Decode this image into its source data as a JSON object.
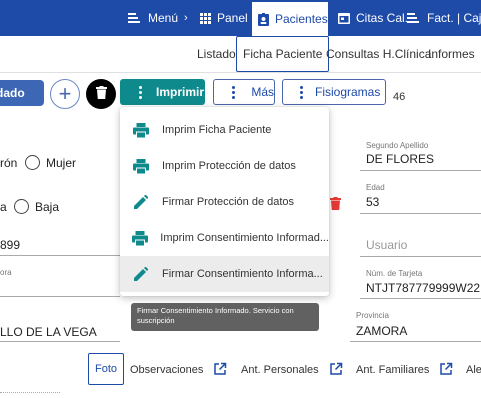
{
  "topbar": {
    "menu_label": "Menú",
    "panel_label": "Panel",
    "patients_label": "Pacientes",
    "appointments_label": "Citas Cal.",
    "billing_label": "Fact. | Caja"
  },
  "subnav": {
    "list": "Listado",
    "patient_file": "Ficha Paciente",
    "clinical_history": "Consultas H.Clínica",
    "reports": "Informes"
  },
  "toolbar": {
    "save_label": "dado",
    "add_label": "+",
    "print_label": "Imprimir",
    "more_label": "Más",
    "physiograms_label": "Fisiogramas",
    "count": "46"
  },
  "form": {
    "sex_option_male": "rón",
    "sex_option_female": "Mujer",
    "status_option_a": "a",
    "status_option_baja": "Baja",
    "phone_fragment": "899",
    "second_surname_label": "Segundo Apellido",
    "second_surname_value": "DE FLORES",
    "age_label": "Edad",
    "age_value": "53",
    "user_placeholder": "Usuario",
    "label_fragment": "ora",
    "card_number_label": "Núm. de Tarjeta",
    "card_number_value": "NTJT787779999W22",
    "town_fragment": "LLO DE LA VEGA",
    "province_label": "Provincia",
    "province_value": "ZAMORA"
  },
  "print_menu": {
    "items": [
      {
        "label": "Imprim Ficha Paciente",
        "icon": "printer-icon"
      },
      {
        "label": "Imprim Protección de datos",
        "icon": "printer-icon"
      },
      {
        "label": "Firmar Protección de datos",
        "icon": "pencil-icon"
      },
      {
        "label": "Imprim Consentimiento Informad...",
        "icon": "printer-icon"
      },
      {
        "label": "Firmar Consentimiento Informa...",
        "icon": "pencil-icon"
      }
    ],
    "tooltip": "Firmar Consentimiento Informado. Servicio con suscripción"
  },
  "tabs": {
    "photo": "Foto",
    "observations": "Observaciones",
    "personal_history": "Ant. Personales",
    "family_history": "Ant. Familiares",
    "allergies_fragment": "Ale"
  },
  "colors": {
    "primary": "#1e4aa8",
    "teal": "#0f8a8c",
    "danger": "#e53935"
  }
}
